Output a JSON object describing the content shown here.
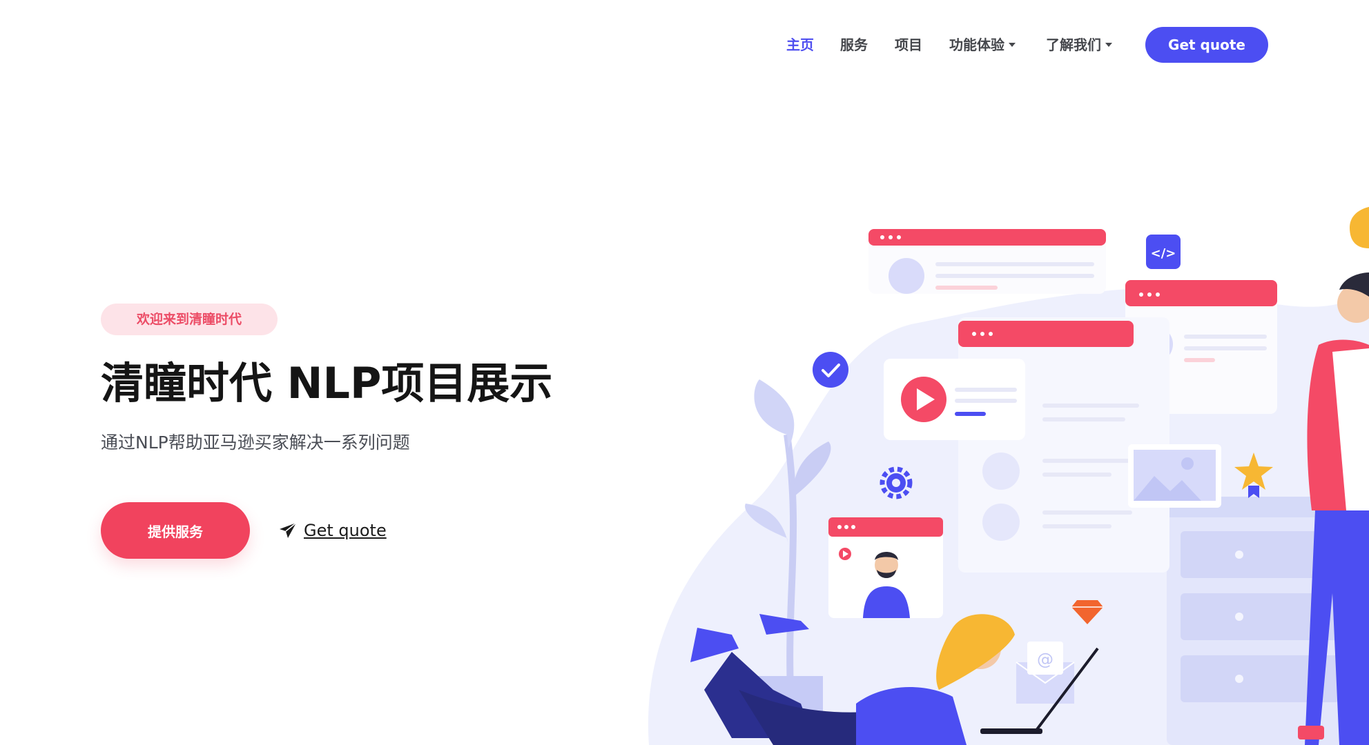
{
  "nav": {
    "items": [
      {
        "label": "主页",
        "active": true
      },
      {
        "label": "服务",
        "active": false
      },
      {
        "label": "项目",
        "active": false
      },
      {
        "label": "功能体验",
        "active": false,
        "dropdown": true
      },
      {
        "label": "了解我们",
        "active": false,
        "dropdown": true
      }
    ],
    "cta_label": "Get quote"
  },
  "hero": {
    "badge": "欢迎来到清瞳时代",
    "title": "清瞳时代 NLP项目展示",
    "subtitle": "通过NLP帮助亚马逊买家解决一系列问题",
    "primary_button": "提供服务",
    "secondary_link": "Get quote",
    "secondary_icon": "paper-plane-icon"
  },
  "colors": {
    "accent": "#4c4ef2",
    "primary": "#f1435e",
    "badge_bg": "#fde3e8",
    "badge_text": "#ec4c66"
  }
}
